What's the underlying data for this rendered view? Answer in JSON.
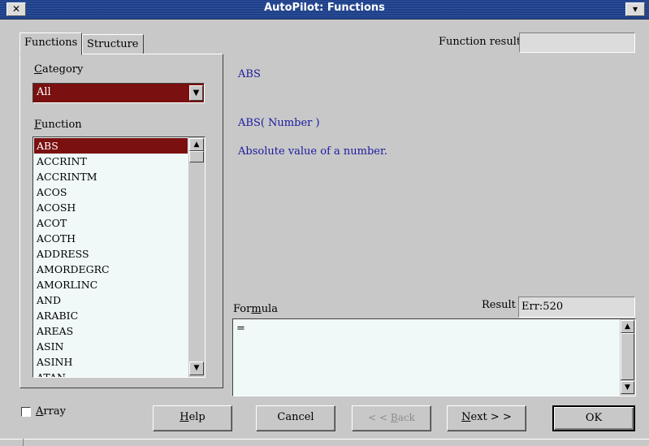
{
  "window": {
    "title": "AutoPilot: Functions",
    "close_icon": "close-icon",
    "menu_icon": "window-menu-icon"
  },
  "tabs": [
    {
      "label": "Functions"
    },
    {
      "label": "Structure"
    }
  ],
  "function_result": {
    "label": "Function result",
    "value": ""
  },
  "category": {
    "label": "Category",
    "selected": "All"
  },
  "function_list": {
    "label": "Function",
    "items": [
      "ABS",
      "ACCRINT",
      "ACCRINTM",
      "ACOS",
      "ACOSH",
      "ACOT",
      "ACOTH",
      "ADDRESS",
      "AMORDEGRC",
      "AMORLINC",
      "AND",
      "ARABIC",
      "AREAS",
      "ASIN",
      "ASINH",
      "ATAN"
    ],
    "selected_index": 0
  },
  "details": {
    "name": "ABS",
    "syntax": "ABS( Number )",
    "description": "Absolute value of a number."
  },
  "formula": {
    "label": "Formula",
    "value": "="
  },
  "result": {
    "label": "Result",
    "value": "Err:520"
  },
  "array": {
    "label": "Array",
    "checked": false
  },
  "buttons": {
    "help": "Help",
    "cancel": "Cancel",
    "back": "< < Back",
    "next": "Next > >",
    "ok": "OK"
  },
  "colors": {
    "titlebar": "#1c3f8a",
    "selection": "#7a1010",
    "info_text": "#1a1aa0",
    "background": "#c8c8c8"
  }
}
